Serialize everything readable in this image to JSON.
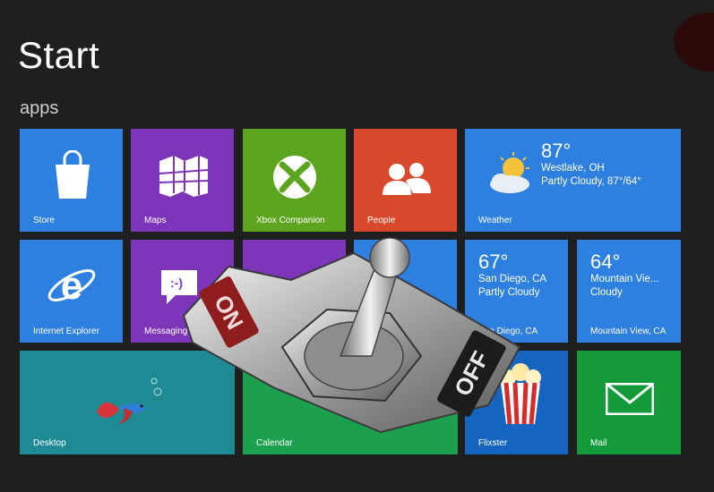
{
  "screen": {
    "title": "Start",
    "group_label": "apps"
  },
  "tiles": {
    "store": {
      "label": "Store",
      "color": "#2d7fe0"
    },
    "maps": {
      "label": "Maps",
      "color": "#7d36b9"
    },
    "xbox": {
      "label": "Xbox Companion",
      "color": "#5ea51f"
    },
    "people": {
      "label": "People",
      "color": "#d8482a"
    },
    "weather": {
      "label": "Weather",
      "color": "#2d7fe0",
      "temp": "87°",
      "location": "Westlake, OH",
      "condition": "Partly Cloudy, 87°/64°"
    },
    "ie": {
      "label": "Internet Explorer",
      "color": "#2d7fe0"
    },
    "messaging": {
      "label": "Messaging",
      "color": "#7d36b9",
      "emoticon": ":-)"
    },
    "purple3": {
      "color": "#7d36b9"
    },
    "blue4": {
      "color": "#2d7fe0"
    },
    "weather_sd": {
      "label": "San Diego, CA",
      "color": "#2d7fe0",
      "temp": "67°",
      "location": "San Diego, CA",
      "condition": "Partly Cloudy"
    },
    "weather_mv": {
      "label": "Mountain View, CA",
      "color": "#2d7fe0",
      "temp": "64°",
      "location": "Mountain Vie...",
      "condition": "Cloudy"
    },
    "desktop": {
      "label": "Desktop",
      "color": "#1d8a94"
    },
    "calendar": {
      "label": "Calendar",
      "color": "#1aa04f"
    },
    "flixster": {
      "label": "Flixster",
      "color": "#1565c0"
    },
    "mail": {
      "label": "Mail",
      "color": "#139a3b"
    }
  },
  "toggle_switch": {
    "on_label": "ON",
    "off_label": "OFF"
  }
}
